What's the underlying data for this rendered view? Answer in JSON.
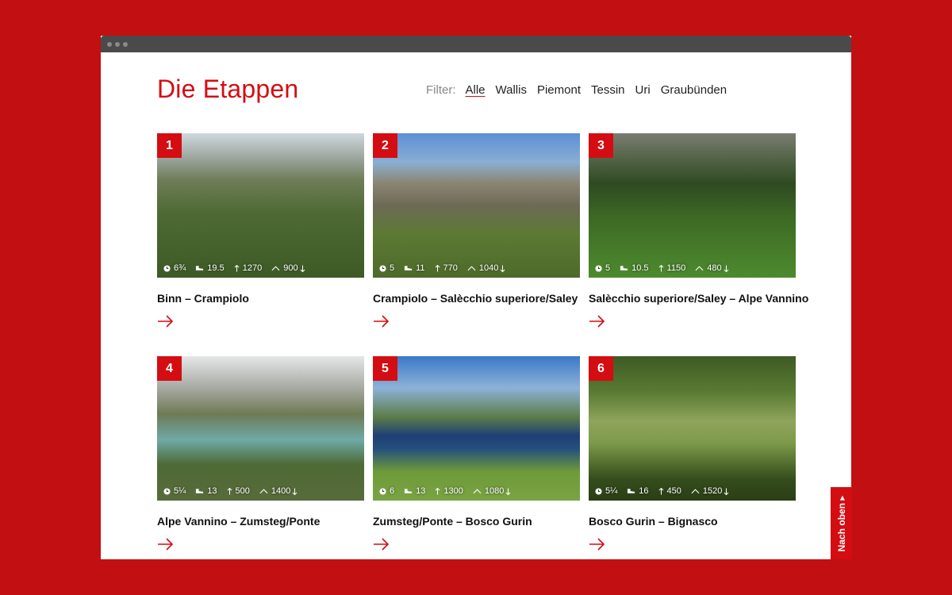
{
  "page": {
    "title": "Die Etappen",
    "filter_label": "Filter:",
    "filters": [
      "Alle",
      "Wallis",
      "Piemont",
      "Tessin",
      "Uri",
      "Graubünden"
    ],
    "active_filter": "Alle",
    "back_to_top": "Nach oben ▸"
  },
  "colors": {
    "accent": "#d40d12",
    "background": "#c20f12"
  },
  "stages": [
    {
      "number": "1",
      "title": "Binn – Crampiolo",
      "time": "6¾",
      "distance": "19.5",
      "ascent": "1270",
      "descent": "900"
    },
    {
      "number": "2",
      "title": "Crampiolo – Salècchio superiore/Saley",
      "time": "5",
      "distance": "11",
      "ascent": "770",
      "descent": "1040"
    },
    {
      "number": "3",
      "title": "Salècchio superiore/Saley – Alpe Vannino",
      "time": "5",
      "distance": "10.5",
      "ascent": "1150",
      "descent": "480"
    },
    {
      "number": "4",
      "title": "Alpe Vannino – Zumsteg/Ponte",
      "time": "5¼",
      "distance": "13",
      "ascent": "500",
      "descent": "1400"
    },
    {
      "number": "5",
      "title": "Zumsteg/Ponte – Bosco Gurin",
      "time": "6",
      "distance": "13",
      "ascent": "1300",
      "descent": "1080"
    },
    {
      "number": "6",
      "title": "Bosco Gurin – Bignasco",
      "time": "5¼",
      "distance": "16",
      "ascent": "450",
      "descent": "1520"
    }
  ]
}
